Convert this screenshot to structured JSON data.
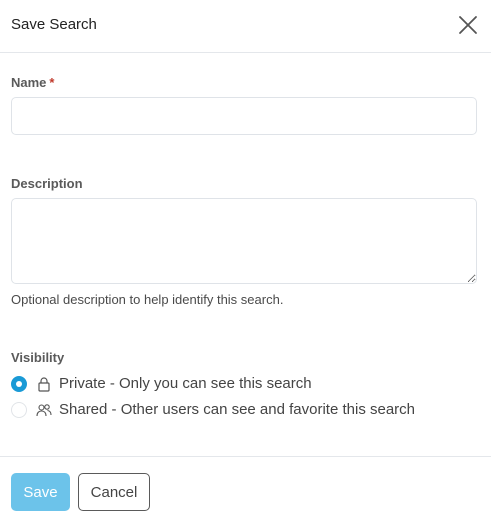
{
  "dialog": {
    "title": "Save Search"
  },
  "form": {
    "name": {
      "label": "Name",
      "required_marker": "*",
      "value": "",
      "placeholder": ""
    },
    "description": {
      "label": "Description",
      "value": "",
      "placeholder": "",
      "hint": "Optional description to help identify this search."
    },
    "visibility": {
      "label": "Visibility",
      "selected": "private",
      "options": [
        {
          "id": "private",
          "icon": "lock-icon",
          "label": "Private - Only you can see this search",
          "checked": true
        },
        {
          "id": "shared",
          "icon": "users-icon",
          "label": "Shared - Other users can see and favorite this search",
          "checked": false
        }
      ]
    }
  },
  "footer": {
    "save_label": "Save",
    "cancel_label": "Cancel"
  },
  "colors": {
    "accent": "#1a9ad6",
    "save_button": "#6cc3ea",
    "required": "#c0392b",
    "border": "#dfe3e8"
  }
}
